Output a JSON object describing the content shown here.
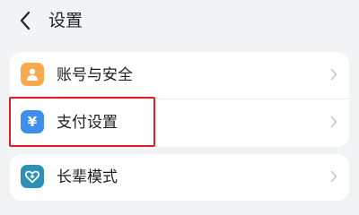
{
  "header": {
    "title": "设置",
    "back_icon": "chevron-left-icon"
  },
  "settings_groups": [
    {
      "items": [
        {
          "label": "账号与安全",
          "icon": "person-icon",
          "icon_color": "#f6a94d"
        },
        {
          "label": "支付设置",
          "icon": "yuan-icon",
          "icon_color": "#3d8fea",
          "highlighted": true
        }
      ]
    },
    {
      "items": [
        {
          "label": "长辈模式",
          "icon": "heart-shield-icon",
          "icon_color": "#2f8fb5"
        }
      ]
    }
  ],
  "icons": {
    "yuan_symbol": "¥"
  },
  "colors": {
    "background": "#f1f3f5",
    "highlight_border": "#e02020"
  }
}
